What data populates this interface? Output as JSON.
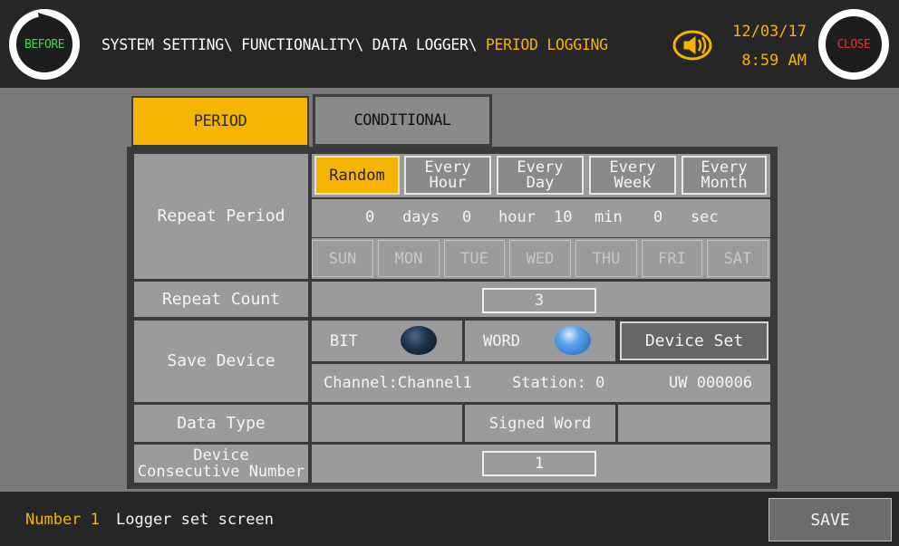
{
  "header": {
    "before_label": "BEFORE",
    "close_label": "CLOSE",
    "breadcrumb_path": "SYSTEM SETTING\\ FUNCTIONALITY\\ DATA LOGGER\\ ",
    "breadcrumb_current": "PERIOD LOGGING",
    "date": "12/03/17",
    "time": "8:59 AM"
  },
  "tabs": [
    {
      "label": "PERIOD",
      "active": true
    },
    {
      "label": "CONDITIONAL",
      "active": false
    }
  ],
  "repeat_period": {
    "label": "Repeat Period",
    "options": [
      {
        "line1": "Random",
        "line2": "",
        "selected": true
      },
      {
        "line1": "Every",
        "line2": "Hour",
        "selected": false
      },
      {
        "line1": "Every",
        "line2": "Day",
        "selected": false
      },
      {
        "line1": "Every",
        "line2": "Week",
        "selected": false
      },
      {
        "line1": "Every",
        "line2": "Month",
        "selected": false
      }
    ],
    "days": "0",
    "days_unit": "days",
    "hour": "0",
    "hour_unit": "hour",
    "min": "10",
    "min_unit": "min",
    "sec": "0",
    "sec_unit": "sec",
    "weekdays": [
      "SUN",
      "MON",
      "TUE",
      "WED",
      "THU",
      "FRI",
      "SAT"
    ]
  },
  "repeat_count": {
    "label": "Repeat Count",
    "value": "3"
  },
  "save_device": {
    "label": "Save Device",
    "bit_label": "BIT",
    "word_label": "WORD",
    "selected": "WORD",
    "device_set_label": "Device Set",
    "channel_text": "Channel:Channel1",
    "station_text": "Station:  0",
    "address": "UW 000006"
  },
  "data_type": {
    "label": "Data Type",
    "value": "Signed Word"
  },
  "device_consecutive": {
    "label_line1": "Device",
    "label_line2": "Consecutive Number",
    "value": "1"
  },
  "footer": {
    "number_text": "Number  1",
    "message": "Logger set screen",
    "save_label": "SAVE"
  },
  "colors": {
    "accent": "#f4b400",
    "before_text": "#44d84a",
    "close_text": "#e7302a",
    "background": "#7a7a7a",
    "bar": "#262626"
  },
  "icons": {
    "before": "refresh-arrow-icon",
    "sound": "speaker-icon"
  }
}
